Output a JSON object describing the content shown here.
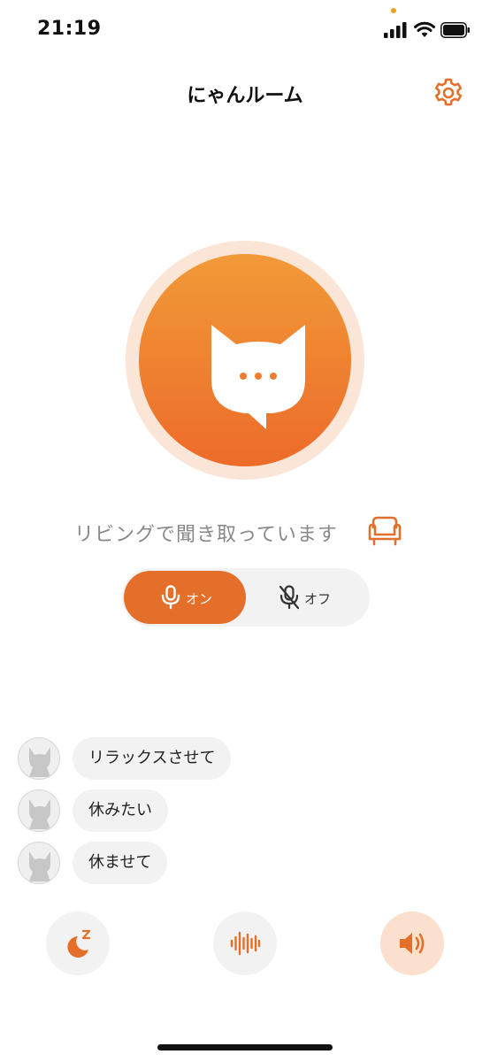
{
  "status_bar": {
    "time": "21:19",
    "icons": [
      "signal-icon",
      "wifi-icon",
      "battery-icon"
    ]
  },
  "header": {
    "title": "にゃんルーム",
    "settings_icon": "gear-icon"
  },
  "hero": {
    "icon": "cat-speech-icon"
  },
  "status": {
    "text": "リビングで聞き取っています",
    "room_icon": "armchair-icon"
  },
  "mic_toggle": {
    "on_label": "オン",
    "off_label": "オフ",
    "selected": "on"
  },
  "messages": [
    {
      "text": "リラックスさせて",
      "avatar": "cat-avatar-icon"
    },
    {
      "text": "休みたい",
      "avatar": "cat-avatar-icon"
    },
    {
      "text": "休ませて",
      "avatar": "cat-avatar-icon"
    }
  ],
  "actions": [
    {
      "icon": "sleep-moon-icon",
      "active": false
    },
    {
      "icon": "sound-wave-icon",
      "active": false
    },
    {
      "icon": "speaker-icon",
      "active": true
    }
  ],
  "colors": {
    "accent": "#e36f2a",
    "accent_light": "#fbe0cd",
    "gradient_top": "#f19a38",
    "gradient_bottom": "#ed6b2a",
    "bubble_bg": "#f2f2f2",
    "status_text": "#888888"
  }
}
